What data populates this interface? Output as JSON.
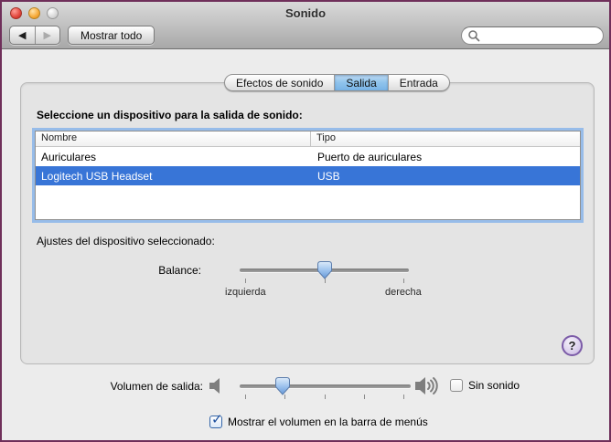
{
  "window": {
    "title": "Sonido"
  },
  "toolbar": {
    "back_icon": "◀",
    "forward_icon": "▶",
    "show_all_label": "Mostrar todo",
    "search_placeholder": ""
  },
  "tabs": [
    {
      "label": "Efectos de sonido",
      "selected": false
    },
    {
      "label": "Salida",
      "selected": true
    },
    {
      "label": "Entrada",
      "selected": false
    }
  ],
  "output_section": {
    "heading": "Seleccione un dispositivo para la salida de sonido:",
    "table": {
      "columns": [
        "Nombre",
        "Tipo"
      ],
      "rows": [
        {
          "name": "Auriculares",
          "type": "Puerto de auriculares",
          "selected": false
        },
        {
          "name": "Logitech USB Headset",
          "type": "USB",
          "selected": true
        }
      ]
    },
    "settings_heading": "Ajustes del dispositivo seleccionado:",
    "balance": {
      "label": "Balance:",
      "left_caption": "izquierda",
      "right_caption": "derecha",
      "value_percent": 50,
      "thumb_left": "50%"
    }
  },
  "help_button": {
    "glyph": "?"
  },
  "volume": {
    "label": "Volumen de salida:",
    "value_percent": 25,
    "thumb_left": "25%",
    "mute_label": "Sin sonido",
    "mute_checked": false
  },
  "menubar_checkbox": {
    "label": "Mostrar el volumen en la barra de menús",
    "checked": true,
    "check_glyph": "✓"
  },
  "colors": {
    "selection_blue": "#3875d7",
    "focus_ring": "#7dafeb",
    "tab_selected_blue": "#8fc3ec",
    "window_border": "#6f2f5a"
  }
}
